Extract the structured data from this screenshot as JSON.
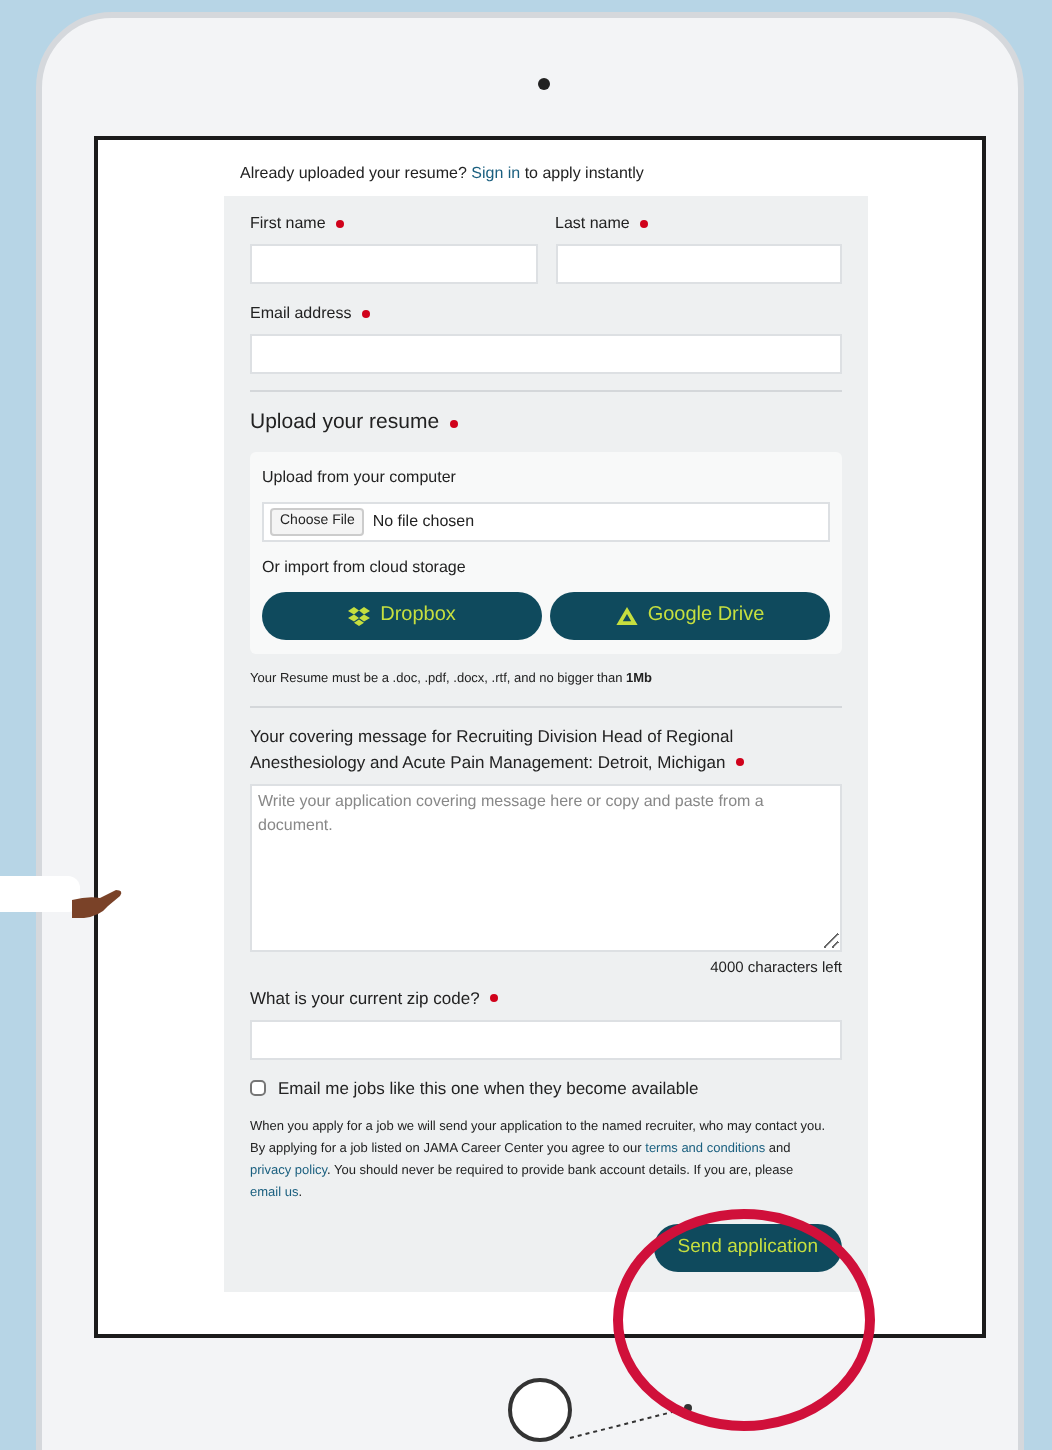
{
  "signin_bar": {
    "before": "Already uploaded your resume?",
    "link": "Sign in",
    "after": "to apply instantly"
  },
  "name_fields": [
    {
      "label": "First name",
      "required": true
    },
    {
      "label": "Last name",
      "required": true
    }
  ],
  "email_field": {
    "label": "Email address",
    "required": true
  },
  "upload": {
    "heading": "Upload your resume",
    "required": true,
    "computer_label": "Upload from your computer",
    "file_button": "Choose File",
    "file_status": "No file chosen",
    "cloud_label": "Or import from cloud storage",
    "cloud_buttons": [
      {
        "label": "Dropbox",
        "kind": "dropbox"
      },
      {
        "label": "Google Drive",
        "kind": "drive"
      }
    ],
    "note": "Your Resume must be a .doc, .pdf, .docx, .rtf, and no bigger than **1Mb**"
  },
  "cover": {
    "label": "Your covering message for Recruiting Division Head of Regional Anesthesiology and Acute Pain Management: Detroit, Michigan",
    "required": true,
    "placeholder": "Write your application covering message here or copy and paste from a document.",
    "counter": "4000 characters left"
  },
  "zip_field": {
    "label": "What is your current zip code?",
    "required": true
  },
  "job_alert": {
    "label": "Email me jobs like this one when they become available",
    "checked": false
  },
  "disclaimer": [
    {
      "kind": "text",
      "text": "When you apply for a job we will send your application to the named recruiter, who may contact you. By applying for a job listed on JAMA Career Center you agree to our "
    },
    {
      "kind": "link",
      "text": "terms and conditions"
    },
    {
      "kind": "text",
      "text": " and "
    },
    {
      "kind": "link",
      "text": "privacy policy"
    },
    {
      "kind": "text",
      "text": ". You should never be required to provide bank account details. If you are, please "
    },
    {
      "kind": "link",
      "text": "email us"
    },
    {
      "kind": "text",
      "text": "."
    }
  ],
  "submit": "Send application"
}
